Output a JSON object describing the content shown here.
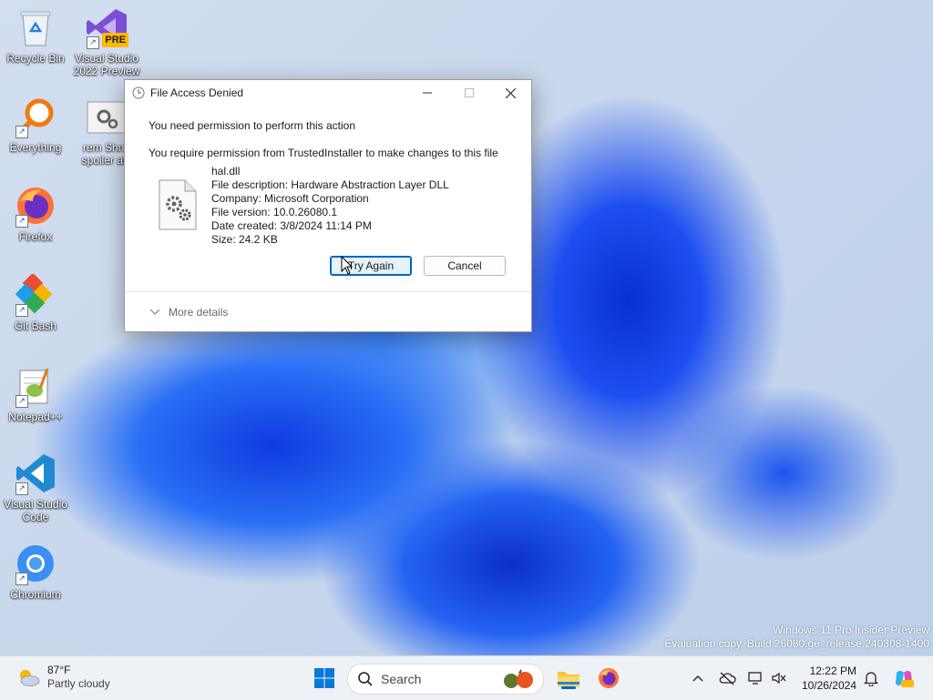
{
  "desktop": {
    "icons": [
      {
        "label": "Recycle Bin"
      },
      {
        "label": "Visual Studio 2022 Preview",
        "badge": "PRE"
      },
      {
        "label": "Everything"
      },
      {
        "label": "rem Shnh spoiler ale"
      },
      {
        "label": "Firefox"
      },
      {
        "label": "Git Bash"
      },
      {
        "label": "Notepad++"
      },
      {
        "label": "Visual Studio Code"
      },
      {
        "label": "Chromium"
      }
    ],
    "watermark": {
      "line1": "Windows 11 Pro Insider Preview",
      "line2": "Evaluation copy. Build 26080.ge_release.240308-1400"
    }
  },
  "dialog": {
    "title": "File Access Denied",
    "message1": "You need permission to perform this action",
    "message2": "You require permission from TrustedInstaller to make changes to this file",
    "file": {
      "name": "hal.dll",
      "description": "File description: Hardware Abstraction Layer DLL",
      "company": "Company: Microsoft Corporation",
      "version": "File version: 10.0.26080.1",
      "created": "Date created: 3/8/2024 11:14 PM",
      "size": "Size: 24.2 KB"
    },
    "buttons": {
      "try_again": "Try Again",
      "cancel": "Cancel"
    },
    "more_details": "More details"
  },
  "taskbar": {
    "weather": {
      "temp": "87°F",
      "condition": "Partly cloudy"
    },
    "search_label": "Search",
    "clock": {
      "time": "12:22 PM",
      "date": "10/26/2024"
    }
  },
  "colors": {
    "accent": "#0067c0"
  }
}
